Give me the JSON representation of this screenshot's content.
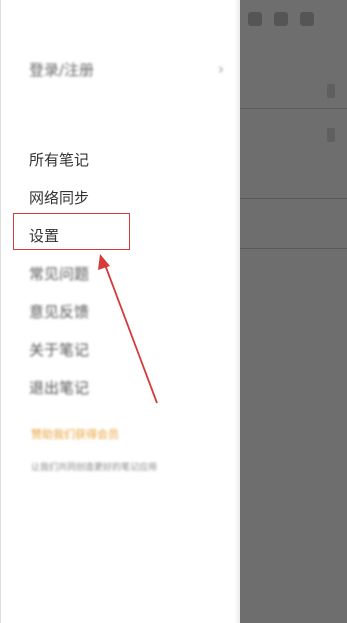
{
  "drawer": {
    "login": {
      "label": "登录/注册",
      "chevron": "›"
    },
    "menu": [
      {
        "label": "所有笔记",
        "blurred": false
      },
      {
        "label": "网络同步",
        "blurred": false
      },
      {
        "label": "设置",
        "blurred": false
      },
      {
        "label": "常见问题",
        "blurred": true
      },
      {
        "label": "意见反馈",
        "blurred": true
      },
      {
        "label": "关于笔记",
        "blurred": true
      },
      {
        "label": "退出笔记",
        "blurred": true
      }
    ],
    "promo_text": "赞助我们获得会员",
    "footer_text": "让我们共同创造更好的笔记应用"
  },
  "annotation": {
    "highlight_target": "设置",
    "highlight_color": "#d63b3b"
  },
  "colors": {
    "overlay": "#6e6e6e",
    "promo": "#e8a23a"
  }
}
